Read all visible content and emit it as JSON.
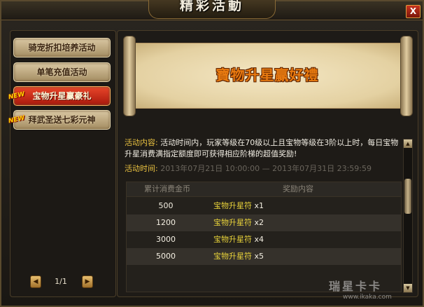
{
  "window": {
    "title": "精彩活動",
    "close_label": "X"
  },
  "sidebar": {
    "items": [
      {
        "label": "骑宠折扣培养活动",
        "active": false,
        "new": false
      },
      {
        "label": "单笔充值活动",
        "active": false,
        "new": false
      },
      {
        "label": "宝物升星赢豪礼",
        "active": true,
        "new": true
      },
      {
        "label": "拜武圣送七彩元神",
        "active": false,
        "new": true
      }
    ],
    "new_badge": "NEW",
    "pager": {
      "prev_icon": "◀",
      "next_icon": "▶",
      "page_text": "1/1"
    }
  },
  "banner": {
    "title": "寶物升星赢好禮"
  },
  "event": {
    "content_label": "活动内容:",
    "content_text": "活动时间内，玩家等级在70级以上且宝物等级在3阶以上时，每日宝物升星消费满指定额度即可获得相应阶梯的超值奖励!",
    "time_label": "活动时间:",
    "time_value": "2013年07月21日 10:00:00 — 2013年07月31日 23:59:59"
  },
  "table": {
    "headers": {
      "cost": "累计消费金币",
      "reward": "奖励内容"
    },
    "rows": [
      {
        "cost": "500",
        "reward_name": "宝物升星符",
        "reward_qty": " x1"
      },
      {
        "cost": "1200",
        "reward_name": "宝物升星符",
        "reward_qty": " x2"
      },
      {
        "cost": "3000",
        "reward_name": "宝物升星符",
        "reward_qty": " x4"
      },
      {
        "cost": "5000",
        "reward_name": "宝物升星符",
        "reward_qty": " x5"
      }
    ]
  },
  "scrollbar": {
    "up_icon": "▲",
    "down_icon": "▼"
  },
  "watermark": {
    "brand": "瑞星卡卡",
    "url": "www.ikaka.com"
  }
}
